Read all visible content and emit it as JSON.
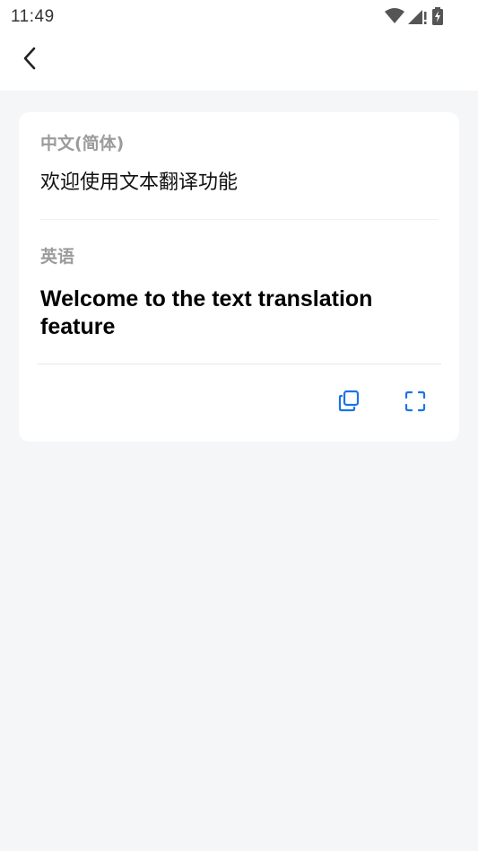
{
  "status_bar": {
    "time": "11:49",
    "icons": [
      "wifi-icon",
      "signal-alert-icon",
      "battery-charging-icon"
    ]
  },
  "header": {
    "back_icon": "chevron-left-icon"
  },
  "translation_card": {
    "source_language": "中文(简体)",
    "source_text": "欢迎使用文本翻译功能",
    "target_language": "英语",
    "target_text": "Welcome to the text translation feature",
    "actions": [
      {
        "icon": "copy-icon"
      },
      {
        "icon": "fullscreen-icon"
      }
    ]
  },
  "colors": {
    "background": "#f5f6f8",
    "card": "#ffffff",
    "accent": "#1a73e8",
    "label_gray": "#9b9b9b"
  }
}
